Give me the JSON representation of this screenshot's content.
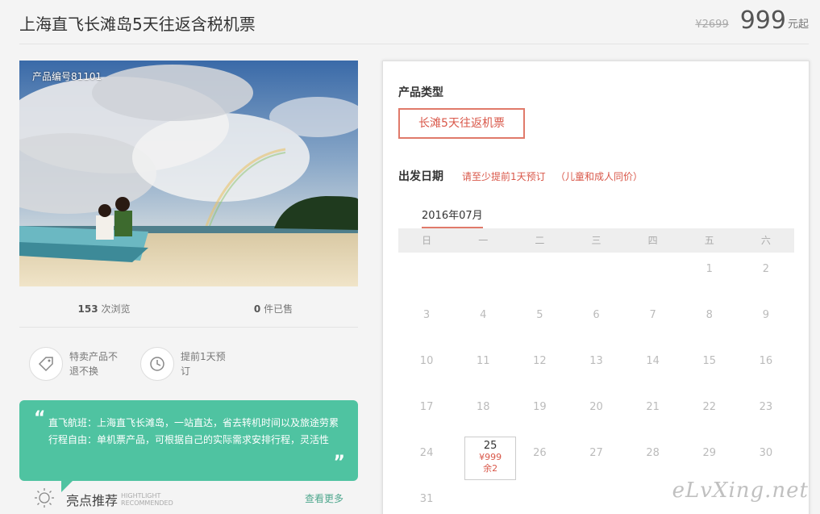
{
  "header": {
    "title": "上海直飞长滩岛5天往返含税机票",
    "old_price": "¥2699",
    "price": "999",
    "price_unit": "元起"
  },
  "product": {
    "number_label": "产品编号81101",
    "views_count": "153",
    "views_label": "次浏览",
    "sold_count": "0",
    "sold_label": "件已售"
  },
  "features": [
    {
      "icon": "tag-icon",
      "text": "特卖产品不退不换"
    },
    {
      "icon": "clock-icon",
      "text": "提前1天预订"
    }
  ],
  "bubble": {
    "open_quote": "“",
    "close_quote": "”",
    "line1": "直飞航班：上海直飞长滩岛，一站直达，省去转机时间以及旅途劳累",
    "line2": "行程自由：单机票产品，可根据自己的实际需求安排行程，灵活性"
  },
  "highlight": {
    "icon": "sun-icon",
    "title": "亮点推荐",
    "en1": "HIGHTLIGHT",
    "en2": "RECOMMENDED",
    "more": "查看更多"
  },
  "booking": {
    "type_label": "产品类型",
    "type_option": "长滩5天往返机票",
    "date_label": "出发日期",
    "note1": "请至少提前1天预订",
    "note2": "（儿童和成人同价）",
    "month": "2016年07月",
    "weekdays": [
      "日",
      "一",
      "二",
      "三",
      "四",
      "五",
      "六"
    ],
    "weeks": [
      [
        "",
        "",
        "",
        "",
        "",
        "1",
        "2"
      ],
      [
        "3",
        "4",
        "5",
        "6",
        "7",
        "8",
        "9"
      ],
      [
        "10",
        "11",
        "12",
        "13",
        "14",
        "15",
        "16"
      ],
      [
        "17",
        "18",
        "19",
        "20",
        "21",
        "22",
        "23"
      ],
      [
        "24",
        "25",
        "26",
        "27",
        "28",
        "29",
        "30"
      ],
      [
        "31",
        "",
        "",
        "",
        "",
        "",
        ""
      ]
    ],
    "available": {
      "day": "25",
      "price": "¥999",
      "remaining": "余2"
    }
  },
  "watermark": "eLvXing.net",
  "colors": {
    "accent": "#d9584a",
    "green": "#4fc3a1",
    "link_green": "#4fa78e"
  }
}
